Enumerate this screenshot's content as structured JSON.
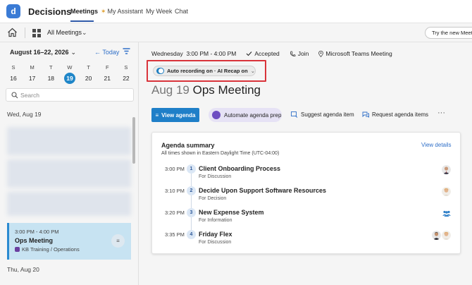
{
  "app": {
    "logo_letter": "d",
    "name": "Decisions"
  },
  "nav": {
    "items": [
      {
        "label": "Meetings",
        "active": true
      },
      {
        "label": "My Assistant",
        "icon": "sparkle-icon"
      },
      {
        "label": "My Week"
      },
      {
        "label": "Chat"
      }
    ]
  },
  "toolbar": {
    "view_label": "All Meetings",
    "try_new_label": "Try the new Meeti"
  },
  "calendar": {
    "week_range": "August 16–22, 2026",
    "today_label": "Today",
    "days": [
      {
        "letter": "S",
        "num": "16"
      },
      {
        "letter": "M",
        "num": "17"
      },
      {
        "letter": "T",
        "num": "18"
      },
      {
        "letter": "W",
        "num": "19",
        "selected": true
      },
      {
        "letter": "T",
        "num": "20"
      },
      {
        "letter": "F",
        "num": "21"
      },
      {
        "letter": "S",
        "num": "22"
      }
    ]
  },
  "search": {
    "placeholder": "Search"
  },
  "meeting_list": {
    "date_1": "Wed, Aug 19",
    "date_2": "Thu, Aug 20",
    "selected": {
      "time": "3:00 PM - 4:00 PM",
      "title": "Ops Meeting",
      "workspace": "KB Training / Operations"
    }
  },
  "meeting": {
    "datetime": "Wednesday  3:00 PM - 4:00 PM",
    "status": "Accepted",
    "join_label": "Join",
    "location": "Microsoft Teams Meeting",
    "recording_label": "Auto recording on · AI Recap on",
    "date": "Aug 19",
    "title": "Ops Meeting"
  },
  "actions": {
    "view_agenda": "View agenda",
    "automate": "Automate agenda prep",
    "suggest": "Suggest agenda item",
    "request": "Request agenda items",
    "more": "···"
  },
  "agenda": {
    "title": "Agenda summary",
    "timezone_note": "All times shown in Eastern Daylight Time (UTC-04:00)",
    "view_details": "View details",
    "items": [
      {
        "time": "3:00 PM",
        "num": "1",
        "title": "Client Onboarding Process",
        "type": "For Discussion",
        "presenter": "avatar"
      },
      {
        "time": "3:10 PM",
        "num": "2",
        "title": "Decide Upon Support Software Resources",
        "type": "For Decision",
        "presenter": "avatar"
      },
      {
        "time": "3:20 PM",
        "num": "3",
        "title": "New Expense System",
        "type": "For Information",
        "presenter": "people-icon"
      },
      {
        "time": "3:35 PM",
        "num": "4",
        "title": "Friday Flex",
        "type": "For Discussion",
        "presenter": "avatars"
      }
    ]
  },
  "colors": {
    "brand": "#3a7bd5",
    "accent": "#1f7fc8",
    "highlight_box": "#d9343b",
    "selected_card": "#c7e3f2",
    "ai_pill": "#e6e2f5"
  }
}
